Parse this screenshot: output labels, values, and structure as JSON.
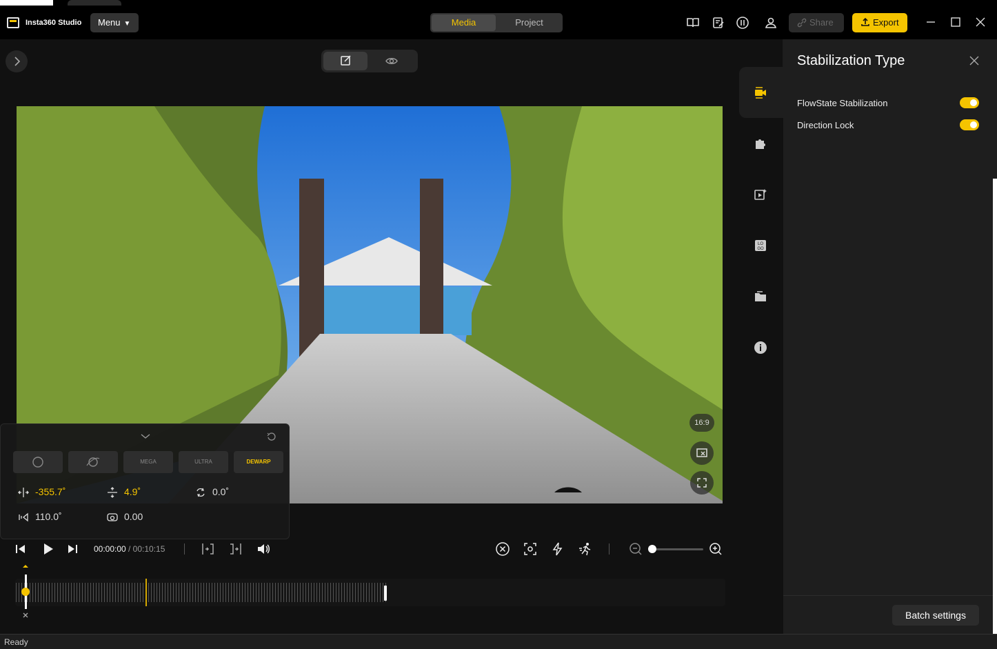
{
  "app": {
    "name": "Insta360 Studio",
    "menu_label": "Menu"
  },
  "header_tabs": [
    {
      "label": "Media",
      "active": true
    },
    {
      "label": "Project",
      "active": false
    }
  ],
  "header_actions": {
    "share_label": "Share",
    "export_label": "Export"
  },
  "preview": {
    "aspect_ratio": "16:9"
  },
  "lens_panel": {
    "modes": [
      "",
      "",
      "MEGA",
      "ULTRA",
      "DEWARP"
    ],
    "active_mode": "DEWARP",
    "params": {
      "pan": "-355.7˚",
      "tilt": "4.9˚",
      "roll": "0.0˚",
      "fov": "110.0˚",
      "distance": "0.00"
    }
  },
  "playback": {
    "current_time": "00:00:00",
    "total_time": "/ 00:10:15"
  },
  "side_panel": {
    "title": "Stabilization Type",
    "options": [
      {
        "label": "FlowState Stabilization",
        "enabled": true
      },
      {
        "label": "Direction Lock",
        "enabled": true
      }
    ],
    "batch_label": "Batch settings"
  },
  "status": {
    "text": "Ready"
  },
  "colors": {
    "accent": "#f5c400",
    "background": "#111111",
    "panel": "#1e1e1e"
  }
}
